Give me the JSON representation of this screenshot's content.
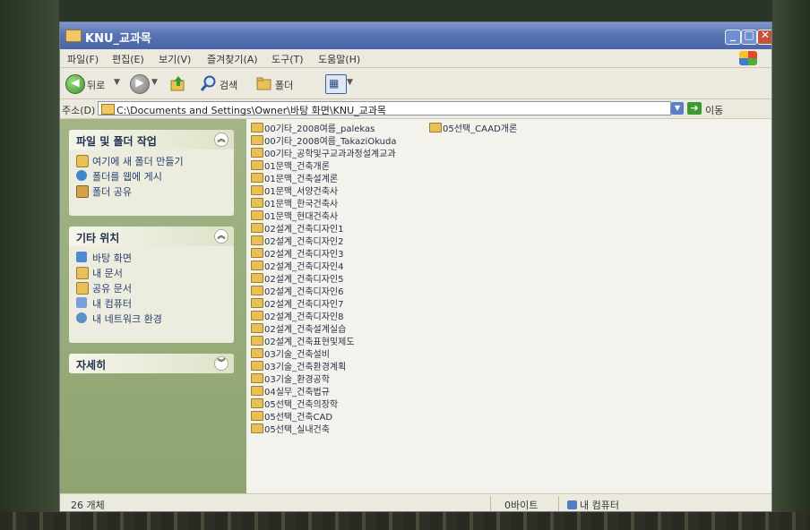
{
  "window": {
    "title": "KNU_교과목"
  },
  "menu": [
    "파일(F)",
    "편집(E)",
    "보기(V)",
    "즐겨찾기(A)",
    "도구(T)",
    "도움말(H)"
  ],
  "toolbar": {
    "back": "뒤로",
    "search": "검색",
    "folders": "폴더"
  },
  "address": {
    "label": "주소(D)",
    "path": "C:\\Documents and Settings\\Owner\\바탕 화면\\KNU_교과목",
    "go": "이동"
  },
  "tasks": {
    "title": "파일 및 폴더 작업",
    "items": [
      "여기에 새 폴더 만들기",
      "폴더를 웹에 게시",
      "폴더 공유"
    ]
  },
  "places": {
    "title": "기타 위치",
    "items": [
      "바탕 화면",
      "내 문서",
      "공유 문서",
      "내 컴퓨터",
      "내 네트워크 환경"
    ]
  },
  "details": {
    "title": "자세히"
  },
  "files_col1": [
    "00기타_2008여름_palekas",
    "00기타_2008여름_TakaziOkuda",
    "00기타_공학및구교과과정설계교과",
    "01문맥_건축개론",
    "01문맥_건축설계론",
    "01문맥_서양건축사",
    "01문맥_한국건축사",
    "01문맥_현대건축사",
    "02설계_건축디자인1",
    "02설계_건축디자인2",
    "02설계_건축디자인3",
    "02설계_건축디자인4",
    "02설계_건축디자인5",
    "02설계_건축디자인6",
    "02설계_건축디자인7",
    "02설계_건축디자인8",
    "02설계_건축설계실습",
    "02설계_건축표현및제도",
    "03기술_건축설비",
    "03기술_건축환경계획",
    "03기술_환경공학",
    "04실무_건축법규",
    "05선택_건축의장학",
    "05선택_건축CAD",
    "05선택_실내건축"
  ],
  "files_col2": [
    "05선택_CAAD개론"
  ],
  "status": {
    "count": "26 개체",
    "size": "0바이트",
    "location": "내 컴퓨터"
  }
}
